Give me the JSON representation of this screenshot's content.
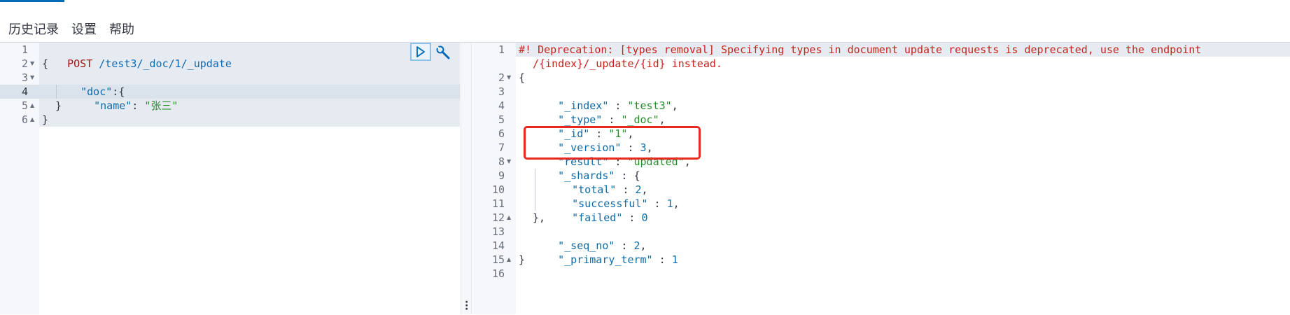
{
  "menu": {
    "history": "历史记录",
    "settings": "设置",
    "help": "帮助"
  },
  "request": {
    "lines": [
      {
        "n": "1",
        "method": "POST",
        "path": " /test3/_doc/1/_update"
      },
      {
        "n": "2",
        "text": "{"
      },
      {
        "n": "3",
        "key": "\"doc\"",
        "rest": ":{"
      },
      {
        "n": "4",
        "key": "\"name\"",
        "sep": ": ",
        "str": "\"张三\""
      },
      {
        "n": "5",
        "text": "}"
      },
      {
        "n": "6",
        "text": "}"
      }
    ]
  },
  "icons": {
    "run": "play-icon",
    "wrench": "wrench-icon",
    "resize": "vertical-dots-icon"
  },
  "response": {
    "warning_line_1": "#! Deprecation: [types removal] Specifying types in document update requests is deprecated, use the endpoint",
    "warning_line_2": "/{index}/_update/{id} instead.",
    "line_numbers": [
      "1",
      "2",
      "3",
      "4",
      "5",
      "6",
      "7",
      "8",
      "9",
      "10",
      "11",
      "12",
      "13",
      "14",
      "15",
      "16"
    ],
    "l2": "{",
    "l3_key": "\"_index\"",
    "l3_val": "\"test3\"",
    "l4_key": "\"_type\"",
    "l4_val": "\"_doc\"",
    "l5_key": "\"_id\"",
    "l5_val": "\"1\"",
    "l6_key": "\"_version\"",
    "l6_val": "3",
    "l7_key": "\"result\"",
    "l7_val": "\"updated\"",
    "l8_key": "\"_shards\"",
    "l8_rest": " : {",
    "l9_key": "\"total\"",
    "l9_val": "2",
    "l10_key": "\"successful\"",
    "l10_val": "1",
    "l11_key": "\"failed\"",
    "l11_val": "0",
    "l12": "},",
    "l13_key": "\"_seq_no\"",
    "l13_val": "2",
    "l14_key": "\"_primary_term\"",
    "l14_val": "1",
    "l15": "}"
  },
  "colors": {
    "accent": "#006bb4",
    "highlight": "#e8291f",
    "string": "#2a8e2f",
    "warning": "#c7231c"
  }
}
